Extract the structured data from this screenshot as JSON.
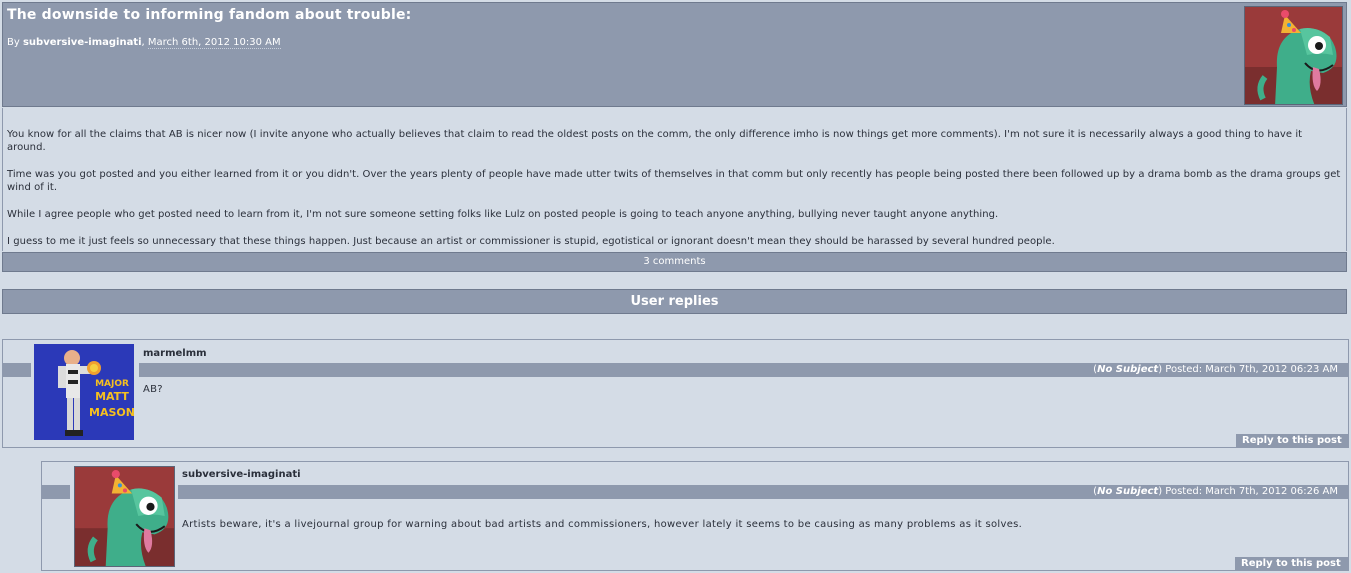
{
  "post": {
    "title": "The downside to informing fandom about trouble:",
    "by_label": "By ",
    "author": "subversive-imaginati",
    "date_prefix": ", ",
    "date": "March 6th, 2012 10:30 AM",
    "avatar_icon": "party-hat-dinosaur-avatar",
    "paragraphs": [
      "You know for all the claims that AB is nicer now (I invite anyone who actually believes that claim to read the oldest posts on the comm, the only difference imho is now things get more comments). I'm not sure it is necessarily always a good thing to have it around.",
      "Time was you got posted and you either learned from it or you didn't. Over the years plenty of people have made utter twits of themselves in that comm but only recently has people being posted there been followed up by a drama bomb as the drama groups get wind of it.",
      "While I agree people who get posted need to learn from it, I'm not sure someone setting folks like Lulz on posted people is going to teach anyone anything, bullying never taught anyone anything.",
      "I guess to me it just feels so unnecessary that these things happen. Just because an artist or commissioner is stupid, egotistical or ignorant doesn't mean they should be harassed by several hundred people."
    ],
    "comments_link": "3 comments"
  },
  "replies_heading": "User replies",
  "comments": [
    {
      "author": "marmelmm",
      "avatar_icon": "major-matt-mason-avatar",
      "avatar_text": [
        "MAJOR",
        "MATT",
        "MASON"
      ],
      "subject_open": "(",
      "subject": "No Subject",
      "subject_close": ")",
      "posted": " Posted: March 7th, 2012 06:23 AM",
      "body": "AB?",
      "reply_label": "Reply to this post"
    },
    {
      "author": "subversive-imaginati",
      "avatar_icon": "party-hat-dinosaur-avatar",
      "subject_open": "(",
      "subject": "No Subject",
      "subject_close": ")",
      "posted": " Posted: March 7th, 2012 06:26 AM",
      "body": "Artists beware, it's a livejournal group for warning about bad artists and commissioners, however lately it seems to be causing as many problems as it solves.",
      "reply_label": "Reply to this post"
    }
  ]
}
